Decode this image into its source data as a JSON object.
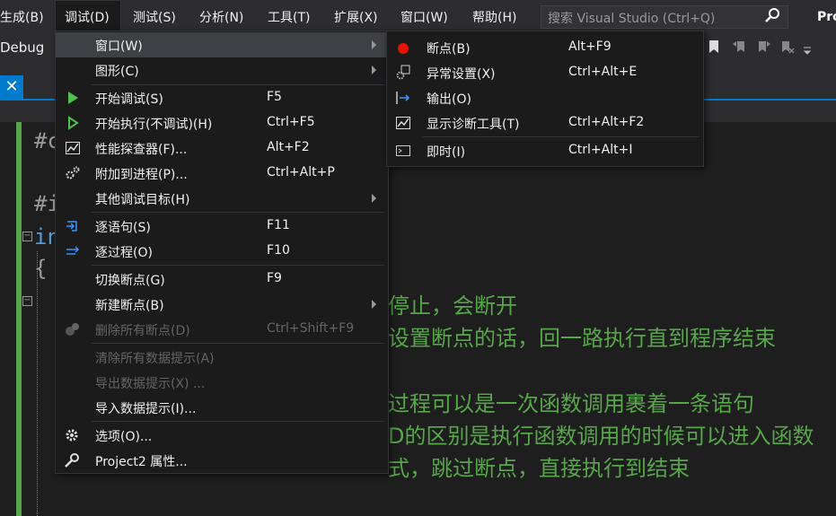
{
  "menubar": {
    "items": [
      "生成(B)",
      "调试(D)",
      "测试(S)",
      "分析(N)",
      "工具(T)",
      "扩展(X)",
      "窗口(W)",
      "帮助(H)"
    ],
    "search_placeholder": "搜索 Visual Studio (Ctrl+Q)",
    "project_abbrev": "Pro"
  },
  "toolbar": {
    "config": "Debug"
  },
  "editor": {
    "code_lines": [
      "#c",
      "#i",
      "in",
      "{"
    ],
    "comments": [
      "停止，会断开",
      "设置断点的话，回一路执行直到程序结束",
      "过程可以是一次函数调用裹着一条语句",
      "D的区别是执行函数调用的时候可以进入函数",
      "式，跳过断点，直接执行到结束"
    ]
  },
  "debug_menu": {
    "items": [
      {
        "label": "窗口(W)",
        "shortcut": "",
        "submenu": true
      },
      {
        "label": "图形(C)",
        "shortcut": "",
        "submenu": true
      },
      {
        "label": "开始调试(S)",
        "shortcut": "F5"
      },
      {
        "label": "开始执行(不调试)(H)",
        "shortcut": "Ctrl+F5"
      },
      {
        "label": "性能探查器(F)...",
        "shortcut": "Alt+F2"
      },
      {
        "label": "附加到进程(P)...",
        "shortcut": "Ctrl+Alt+P"
      },
      {
        "label": "其他调试目标(H)",
        "shortcut": "",
        "submenu": true
      },
      {
        "label": "逐语句(S)",
        "shortcut": "F11"
      },
      {
        "label": "逐过程(O)",
        "shortcut": "F10"
      },
      {
        "label": "切换断点(G)",
        "shortcut": "F9"
      },
      {
        "label": "新建断点(B)",
        "shortcut": "",
        "submenu": true
      },
      {
        "label": "删除所有断点(D)",
        "shortcut": "Ctrl+Shift+F9",
        "disabled": true
      },
      {
        "label": "清除所有数据提示(A)",
        "shortcut": "",
        "disabled": true
      },
      {
        "label": "导出数据提示(X) ...",
        "shortcut": "",
        "disabled": true
      },
      {
        "label": "导入数据提示(I)...",
        "shortcut": ""
      },
      {
        "label": "选项(O)...",
        "shortcut": ""
      },
      {
        "label": "Project2 属性...",
        "shortcut": ""
      }
    ]
  },
  "window_submenu": {
    "items": [
      {
        "label": "断点(B)",
        "shortcut": "Alt+F9"
      },
      {
        "label": "异常设置(X)",
        "shortcut": "Ctrl+Alt+E"
      },
      {
        "label": "输出(O)",
        "shortcut": ""
      },
      {
        "label": "显示诊断工具(T)",
        "shortcut": "Ctrl+Alt+F2"
      },
      {
        "label": "即时(I)",
        "shortcut": "Ctrl+Alt+I"
      }
    ]
  },
  "colors": {
    "accent": "#007acc",
    "comment": "#57a64a",
    "menu_bg": "#1b1b1c",
    "highlight": "#3f3f46",
    "breakpoint": "#e51400"
  }
}
